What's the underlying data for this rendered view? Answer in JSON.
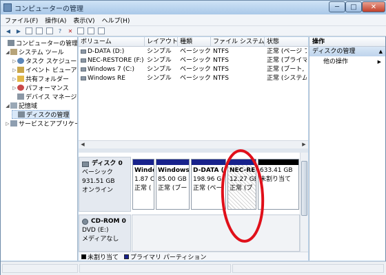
{
  "window": {
    "title": "コンピューターの管理",
    "min_glyph": "─",
    "max_glyph": "□",
    "close_glyph": "✕"
  },
  "menu": [
    "ファイル(F)",
    "操作(A)",
    "表示(V)",
    "ヘルプ(H)"
  ],
  "toolbar_icons": [
    "back-arrow-icon",
    "forward-arrow-icon",
    "up-folder-icon",
    "console-tree-icon",
    "properties-icon",
    "help-icon",
    "delete-icon",
    "refresh-icon",
    "export-icon",
    "settings-icon"
  ],
  "tree": [
    {
      "label": "コンピューターの管理 (",
      "expander": "",
      "icon": "computer-management-icon"
    },
    {
      "label": "システム ツール",
      "expander": "◢",
      "icon": "tools-icon"
    },
    {
      "label": "タスク スケジュー",
      "expander": "▷",
      "icon": "clock-icon"
    },
    {
      "label": "イベント ビューア",
      "expander": "▷",
      "icon": "event-viewer-icon"
    },
    {
      "label": "共有フォルダー",
      "expander": "▷",
      "icon": "shared-folder-icon"
    },
    {
      "label": "パフォーマンス",
      "expander": "▷",
      "icon": "performance-icon"
    },
    {
      "label": "デバイス マネージ",
      "expander": "",
      "icon": "device-manager-icon"
    },
    {
      "label": "記憶域",
      "expander": "◢",
      "icon": "storage-icon"
    },
    {
      "label": "ディスクの管理",
      "expander": "",
      "icon": "disk-management-icon"
    },
    {
      "label": "サービスとアプリケー",
      "expander": "▷",
      "icon": "services-icon"
    }
  ],
  "volume_table": {
    "columns": [
      "ボリューム",
      "レイアウト",
      "種類",
      "ファイル システム",
      "状態"
    ],
    "rows": [
      [
        "D-DATA (D:)",
        "シンプル",
        "ベーシック",
        "NTFS",
        "正常 (ページ フ"
      ],
      [
        "NEC-RESTORE (F:)",
        "シンプル",
        "ベーシック",
        "NTFS",
        "正常 (プライマリ"
      ],
      [
        "Windows 7 (C:)",
        "シンプル",
        "ベーシック",
        "NTFS",
        "正常 (ブート, ク"
      ],
      [
        "Windows RE",
        "シンプル",
        "ベーシック",
        "NTFS",
        "正常 (システム,"
      ]
    ]
  },
  "disks": [
    {
      "name": "ディスク 0",
      "type": "ベーシック",
      "size": "931.51 GB",
      "status": "オンライン",
      "partitions": [
        {
          "name": "Windo",
          "size": "1.87 C",
          "status": "正常 (",
          "bar_color": "#18228c",
          "hatched": false
        },
        {
          "name": "Windows",
          "size": "85.00 GB I",
          "status": "正常 (ブー",
          "bar_color": "#18228c",
          "hatched": false
        },
        {
          "name": "D-DATA (",
          "size": "198.96 G",
          "status": "正常 (ペー",
          "bar_color": "#18228c",
          "hatched": false
        },
        {
          "name": "NEC-RE",
          "size": "12.27 GB",
          "status": "正常 (プ",
          "bar_color": "#18228c",
          "hatched": true
        },
        {
          "name": "",
          "size": "633.41 GB",
          "status": "未割り当て",
          "bar_color": "#000000",
          "hatched": false
        }
      ]
    },
    {
      "name": "CD-ROM 0",
      "type": "DVD (E:)",
      "size": "",
      "status": "メディアなし"
    }
  ],
  "legend": [
    {
      "label": "未割り当て",
      "color": "#000000"
    },
    {
      "label": "プライマリ パーティション",
      "color": "#18228c"
    }
  ],
  "actions": {
    "header": "操作",
    "section": "ディスクの管理",
    "section_caret": "▲",
    "items": [
      "他の操作"
    ],
    "item_caret": "▶"
  },
  "annotation_color": "#e0101a"
}
